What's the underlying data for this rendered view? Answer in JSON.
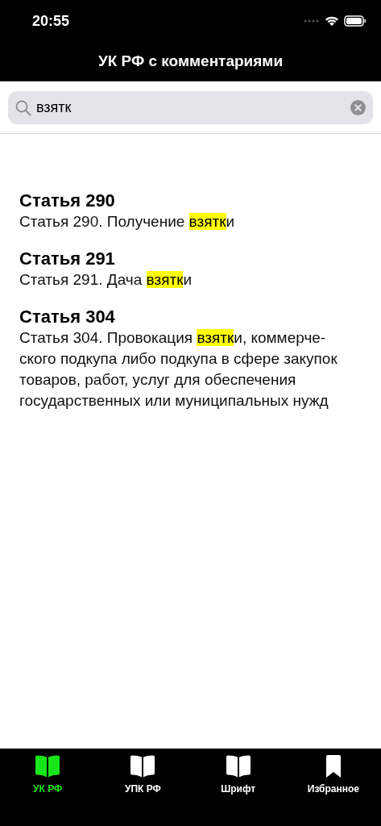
{
  "status_bar": {
    "time": "20:55"
  },
  "nav": {
    "title": "УК РФ с комментариями"
  },
  "search": {
    "value": "взятк"
  },
  "results": [
    {
      "title": "Статья 290",
      "text_before": "Статья 290. Получение ",
      "highlight": "взятк",
      "text_after": "и"
    },
    {
      "title": "Статья 291",
      "text_before": "Статья 291. Дача ",
      "highlight": "взятк",
      "text_after": "и"
    },
    {
      "title": "Статья 304",
      "text_before": "Статья 304. Провокация ",
      "highlight": "взятк",
      "text_after": "и, коммерче-ского подкупа либо подкупа в сфере закупок товаров, работ, услуг для обеспечения государственных или муниципальных нужд"
    }
  ],
  "tabs": [
    {
      "label": "УК РФ",
      "selected": true
    },
    {
      "label": "УПК РФ",
      "selected": false
    },
    {
      "label": "Шрифт",
      "selected": false
    },
    {
      "label": "Избранное",
      "selected": false
    }
  ]
}
